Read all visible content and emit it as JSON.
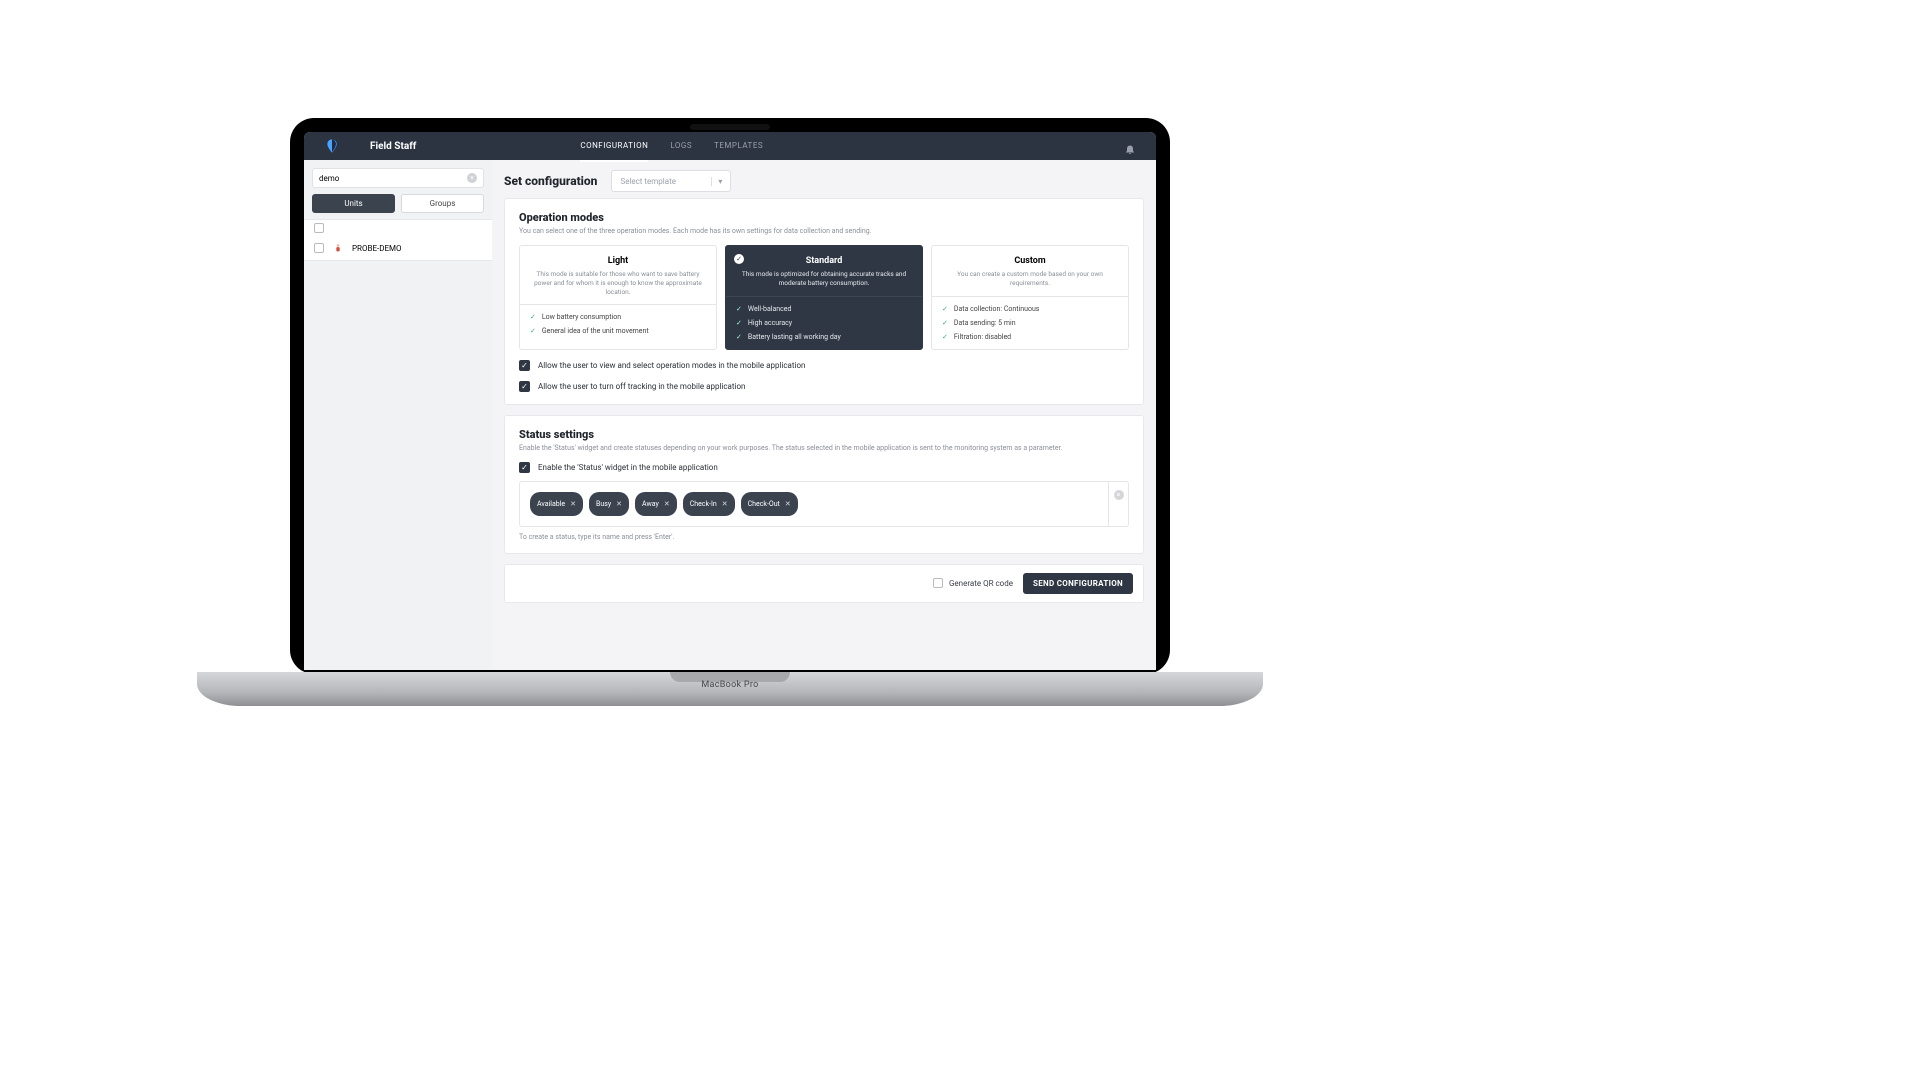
{
  "brand": {
    "name": "Field Staff"
  },
  "nav": {
    "tabs": [
      "CONFIGURATION",
      "LOGS",
      "TEMPLATES"
    ],
    "active_index": 0
  },
  "sidebar": {
    "search_value": "demo",
    "segments": [
      "Units",
      "Groups"
    ],
    "active_segment_index": 0,
    "units": [
      {
        "name": "PROBE-DEMO"
      }
    ]
  },
  "main": {
    "title": "Set configuration",
    "template_select_placeholder": "Select template"
  },
  "operation_modes": {
    "title": "Operation modes",
    "subtitle": "You can select one of the three operation modes. Each mode has its own settings for data collection and sending.",
    "selected_index": 1,
    "modes": [
      {
        "name": "Light",
        "desc": "This mode is suitable for those who want to save battery power and for whom it is enough to know the approximate location.",
        "features": [
          "Low battery consumption",
          "General idea of the unit movement"
        ]
      },
      {
        "name": "Standard",
        "desc": "This mode is optimized for obtaining accurate tracks and moderate battery consumption.",
        "features": [
          "Well-balanced",
          "High accuracy",
          "Battery lasting all working day"
        ]
      },
      {
        "name": "Custom",
        "desc": "You can create a custom mode based on your own requirements.",
        "features": [
          "Data collection: Continuous",
          "Data sending: 5 min",
          "Filtration: disabled"
        ]
      }
    ],
    "allow_view_select_label": "Allow the user to view and select operation modes in the mobile application",
    "allow_turn_off_label": "Allow the user to turn off tracking in the mobile application",
    "allow_view_select_checked": true,
    "allow_turn_off_checked": true
  },
  "status_settings": {
    "title": "Status settings",
    "subtitle": "Enable the 'Status' widget and create statuses depending on your work purposes. The status selected in the mobile application is sent to the monitoring system as a parameter.",
    "enable_label": "Enable the 'Status' widget in the mobile application",
    "enable_checked": true,
    "tags": [
      "Available",
      "Busy",
      "Away",
      "Check-In",
      "Check-Out"
    ],
    "hint": "To create a status, type its name and press 'Enter'."
  },
  "footer": {
    "generate_qr_label": "Generate QR code",
    "generate_qr_checked": false,
    "send_label": "SEND CONFIGURATION"
  },
  "device": {
    "label": "MacBook Pro"
  }
}
